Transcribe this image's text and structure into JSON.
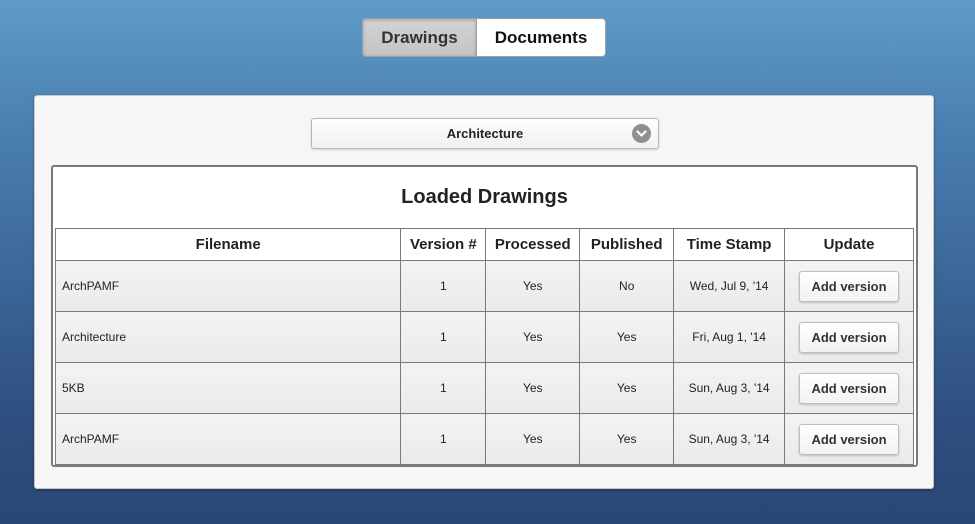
{
  "tabs": {
    "drawings": "Drawings",
    "documents": "Documents"
  },
  "dropdown": {
    "selected": "Architecture"
  },
  "table": {
    "title": "Loaded Drawings",
    "headers": {
      "filename": "Filename",
      "version": "Version #",
      "processed": "Processed",
      "published": "Published",
      "timestamp": "Time Stamp",
      "update": "Update"
    },
    "rows": [
      {
        "filename": "ArchPAMF",
        "version": "1",
        "processed": "Yes",
        "published": "No",
        "timestamp": "Wed, Jul 9, '14",
        "action": "Add version"
      },
      {
        "filename": "Architecture",
        "version": "1",
        "processed": "Yes",
        "published": "Yes",
        "timestamp": "Fri, Aug 1, '14",
        "action": "Add version"
      },
      {
        "filename": "5KB",
        "version": "1",
        "processed": "Yes",
        "published": "Yes",
        "timestamp": "Sun, Aug 3, '14",
        "action": "Add version"
      },
      {
        "filename": "ArchPAMF",
        "version": "1",
        "processed": "Yes",
        "published": "Yes",
        "timestamp": "Sun, Aug 3, '14",
        "action": "Add version"
      }
    ]
  },
  "icons": {
    "dropdown": "chevron-down-icon"
  },
  "colors": {
    "active_tab": "#c8c8c8",
    "inactive_tab": "#ffffff",
    "border": "#7a7a7a"
  }
}
